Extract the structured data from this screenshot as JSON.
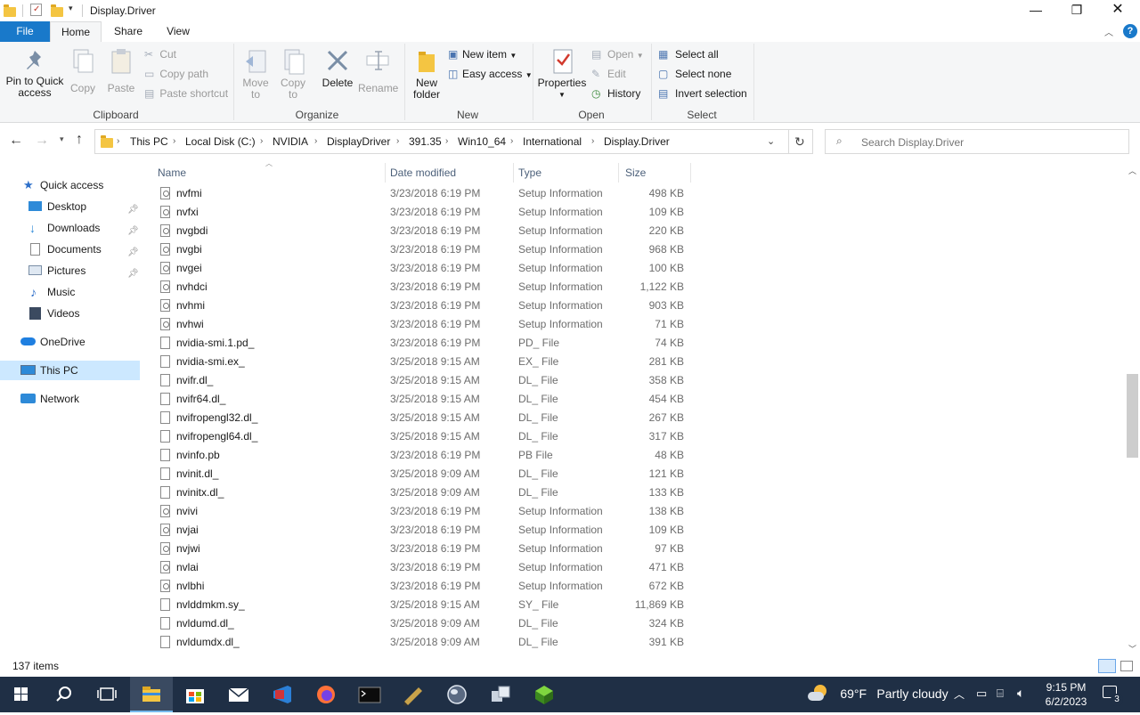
{
  "window": {
    "title": "Display.Driver"
  },
  "ribbon_tabs": {
    "file": "File",
    "home": "Home",
    "share": "Share",
    "view": "View"
  },
  "clipboard": {
    "pin": "Pin to Quick access",
    "copy": "Copy",
    "paste": "Paste",
    "cut": "Cut",
    "copy_path": "Copy path",
    "paste_shortcut": "Paste shortcut",
    "group": "Clipboard"
  },
  "organize": {
    "move_to": "Move to",
    "copy_to": "Copy to",
    "delete": "Delete",
    "rename": "Rename",
    "group": "Organize"
  },
  "new": {
    "new_folder": "New folder",
    "new_item": "New item",
    "easy_access": "Easy access",
    "group": "New"
  },
  "open": {
    "properties": "Properties",
    "open": "Open",
    "edit": "Edit",
    "history": "History",
    "group": "Open"
  },
  "select": {
    "select_all": "Select all",
    "select_none": "Select none",
    "invert": "Invert selection",
    "group": "Select"
  },
  "address": {
    "crumbs": [
      "This PC",
      "Local Disk (C:)",
      "NVIDIA",
      "DisplayDriver",
      "391.35",
      "Win10_64",
      "International",
      "Display.Driver"
    ]
  },
  "search": {
    "placeholder": "Search Display.Driver"
  },
  "nav": {
    "quick_access": "Quick access",
    "desktop": "Desktop",
    "downloads": "Downloads",
    "documents": "Documents",
    "pictures": "Pictures",
    "music": "Music",
    "videos": "Videos",
    "onedrive": "OneDrive",
    "this_pc": "This PC",
    "network": "Network"
  },
  "columns": {
    "name": "Name",
    "date": "Date modified",
    "type": "Type",
    "size": "Size"
  },
  "files": [
    {
      "name": "nvfmi",
      "date": "3/23/2018 6:19 PM",
      "type": "Setup Information",
      "size": "498 KB",
      "icon": "setup"
    },
    {
      "name": "nvfxi",
      "date": "3/23/2018 6:19 PM",
      "type": "Setup Information",
      "size": "109 KB",
      "icon": "setup"
    },
    {
      "name": "nvgbdi",
      "date": "3/23/2018 6:19 PM",
      "type": "Setup Information",
      "size": "220 KB",
      "icon": "setup"
    },
    {
      "name": "nvgbi",
      "date": "3/23/2018 6:19 PM",
      "type": "Setup Information",
      "size": "968 KB",
      "icon": "setup"
    },
    {
      "name": "nvgei",
      "date": "3/23/2018 6:19 PM",
      "type": "Setup Information",
      "size": "100 KB",
      "icon": "setup"
    },
    {
      "name": "nvhdci",
      "date": "3/23/2018 6:19 PM",
      "type": "Setup Information",
      "size": "1,122 KB",
      "icon": "setup"
    },
    {
      "name": "nvhmi",
      "date": "3/23/2018 6:19 PM",
      "type": "Setup Information",
      "size": "903 KB",
      "icon": "setup"
    },
    {
      "name": "nvhwi",
      "date": "3/23/2018 6:19 PM",
      "type": "Setup Information",
      "size": "71 KB",
      "icon": "setup"
    },
    {
      "name": "nvidia-smi.1.pd_",
      "date": "3/23/2018 6:19 PM",
      "type": "PD_ File",
      "size": "74 KB",
      "icon": "file"
    },
    {
      "name": "nvidia-smi.ex_",
      "date": "3/25/2018 9:15 AM",
      "type": "EX_ File",
      "size": "281 KB",
      "icon": "file"
    },
    {
      "name": "nvifr.dl_",
      "date": "3/25/2018 9:15 AM",
      "type": "DL_ File",
      "size": "358 KB",
      "icon": "file"
    },
    {
      "name": "nvifr64.dl_",
      "date": "3/25/2018 9:15 AM",
      "type": "DL_ File",
      "size": "454 KB",
      "icon": "file"
    },
    {
      "name": "nvifropengl32.dl_",
      "date": "3/25/2018 9:15 AM",
      "type": "DL_ File",
      "size": "267 KB",
      "icon": "file"
    },
    {
      "name": "nvifropengl64.dl_",
      "date": "3/25/2018 9:15 AM",
      "type": "DL_ File",
      "size": "317 KB",
      "icon": "file"
    },
    {
      "name": "nvinfo.pb",
      "date": "3/23/2018 6:19 PM",
      "type": "PB File",
      "size": "48 KB",
      "icon": "file"
    },
    {
      "name": "nvinit.dl_",
      "date": "3/25/2018 9:09 AM",
      "type": "DL_ File",
      "size": "121 KB",
      "icon": "file"
    },
    {
      "name": "nvinitx.dl_",
      "date": "3/25/2018 9:09 AM",
      "type": "DL_ File",
      "size": "133 KB",
      "icon": "file"
    },
    {
      "name": "nvivi",
      "date": "3/23/2018 6:19 PM",
      "type": "Setup Information",
      "size": "138 KB",
      "icon": "setup"
    },
    {
      "name": "nvjai",
      "date": "3/23/2018 6:19 PM",
      "type": "Setup Information",
      "size": "109 KB",
      "icon": "setup"
    },
    {
      "name": "nvjwi",
      "date": "3/23/2018 6:19 PM",
      "type": "Setup Information",
      "size": "97 KB",
      "icon": "setup"
    },
    {
      "name": "nvlai",
      "date": "3/23/2018 6:19 PM",
      "type": "Setup Information",
      "size": "471 KB",
      "icon": "setup"
    },
    {
      "name": "nvlbhi",
      "date": "3/23/2018 6:19 PM",
      "type": "Setup Information",
      "size": "672 KB",
      "icon": "setup"
    },
    {
      "name": "nvlddmkm.sy_",
      "date": "3/25/2018 9:15 AM",
      "type": "SY_ File",
      "size": "11,869 KB",
      "icon": "file"
    },
    {
      "name": "nvldumd.dl_",
      "date": "3/25/2018 9:09 AM",
      "type": "DL_ File",
      "size": "324 KB",
      "icon": "file"
    },
    {
      "name": "nvldumdx.dl_",
      "date": "3/25/2018 9:09 AM",
      "type": "DL_ File",
      "size": "391 KB",
      "icon": "file"
    }
  ],
  "status": {
    "items": "137 items"
  },
  "taskbar": {
    "weather_temp": "69°F",
    "weather_desc": "Partly cloudy",
    "time": "9:15 PM",
    "date": "6/2/2023",
    "notifications": "3"
  },
  "colors": {
    "accent": "#1979ca",
    "selection": "#cce8ff",
    "taskbar": "#1f2f45"
  }
}
